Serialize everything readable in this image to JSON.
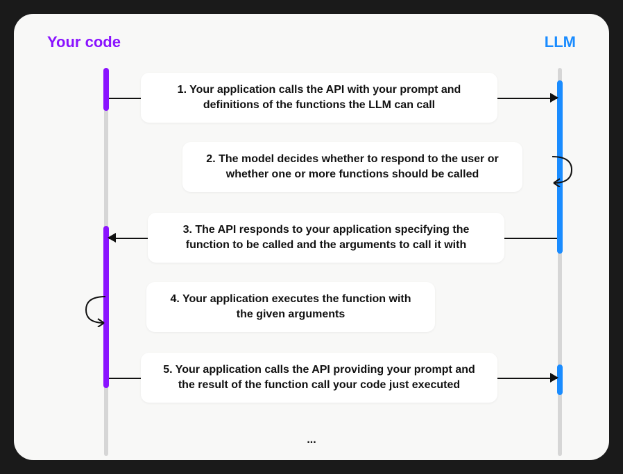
{
  "headers": {
    "left": "Your code",
    "right": "LLM"
  },
  "steps": [
    {
      "n": 1,
      "text": "1. Your application calls the API with your prompt and definitions of the functions the LLM can call"
    },
    {
      "n": 2,
      "text": "2. The model decides whether to respond to the user or whether one or more functions should be called"
    },
    {
      "n": 3,
      "text": "3. The API responds to your application specifying the function to be called and the arguments to call it with"
    },
    {
      "n": 4,
      "text": "4. Your application executes the function with the given  arguments"
    },
    {
      "n": 5,
      "text": "5. Your application calls the API providing your prompt and the result of the function call your code just executed"
    }
  ],
  "ellipsis": "...",
  "colors": {
    "your_code": "#8a13ff",
    "llm": "#1a8cff",
    "card_bg": "#f8f8f7"
  }
}
